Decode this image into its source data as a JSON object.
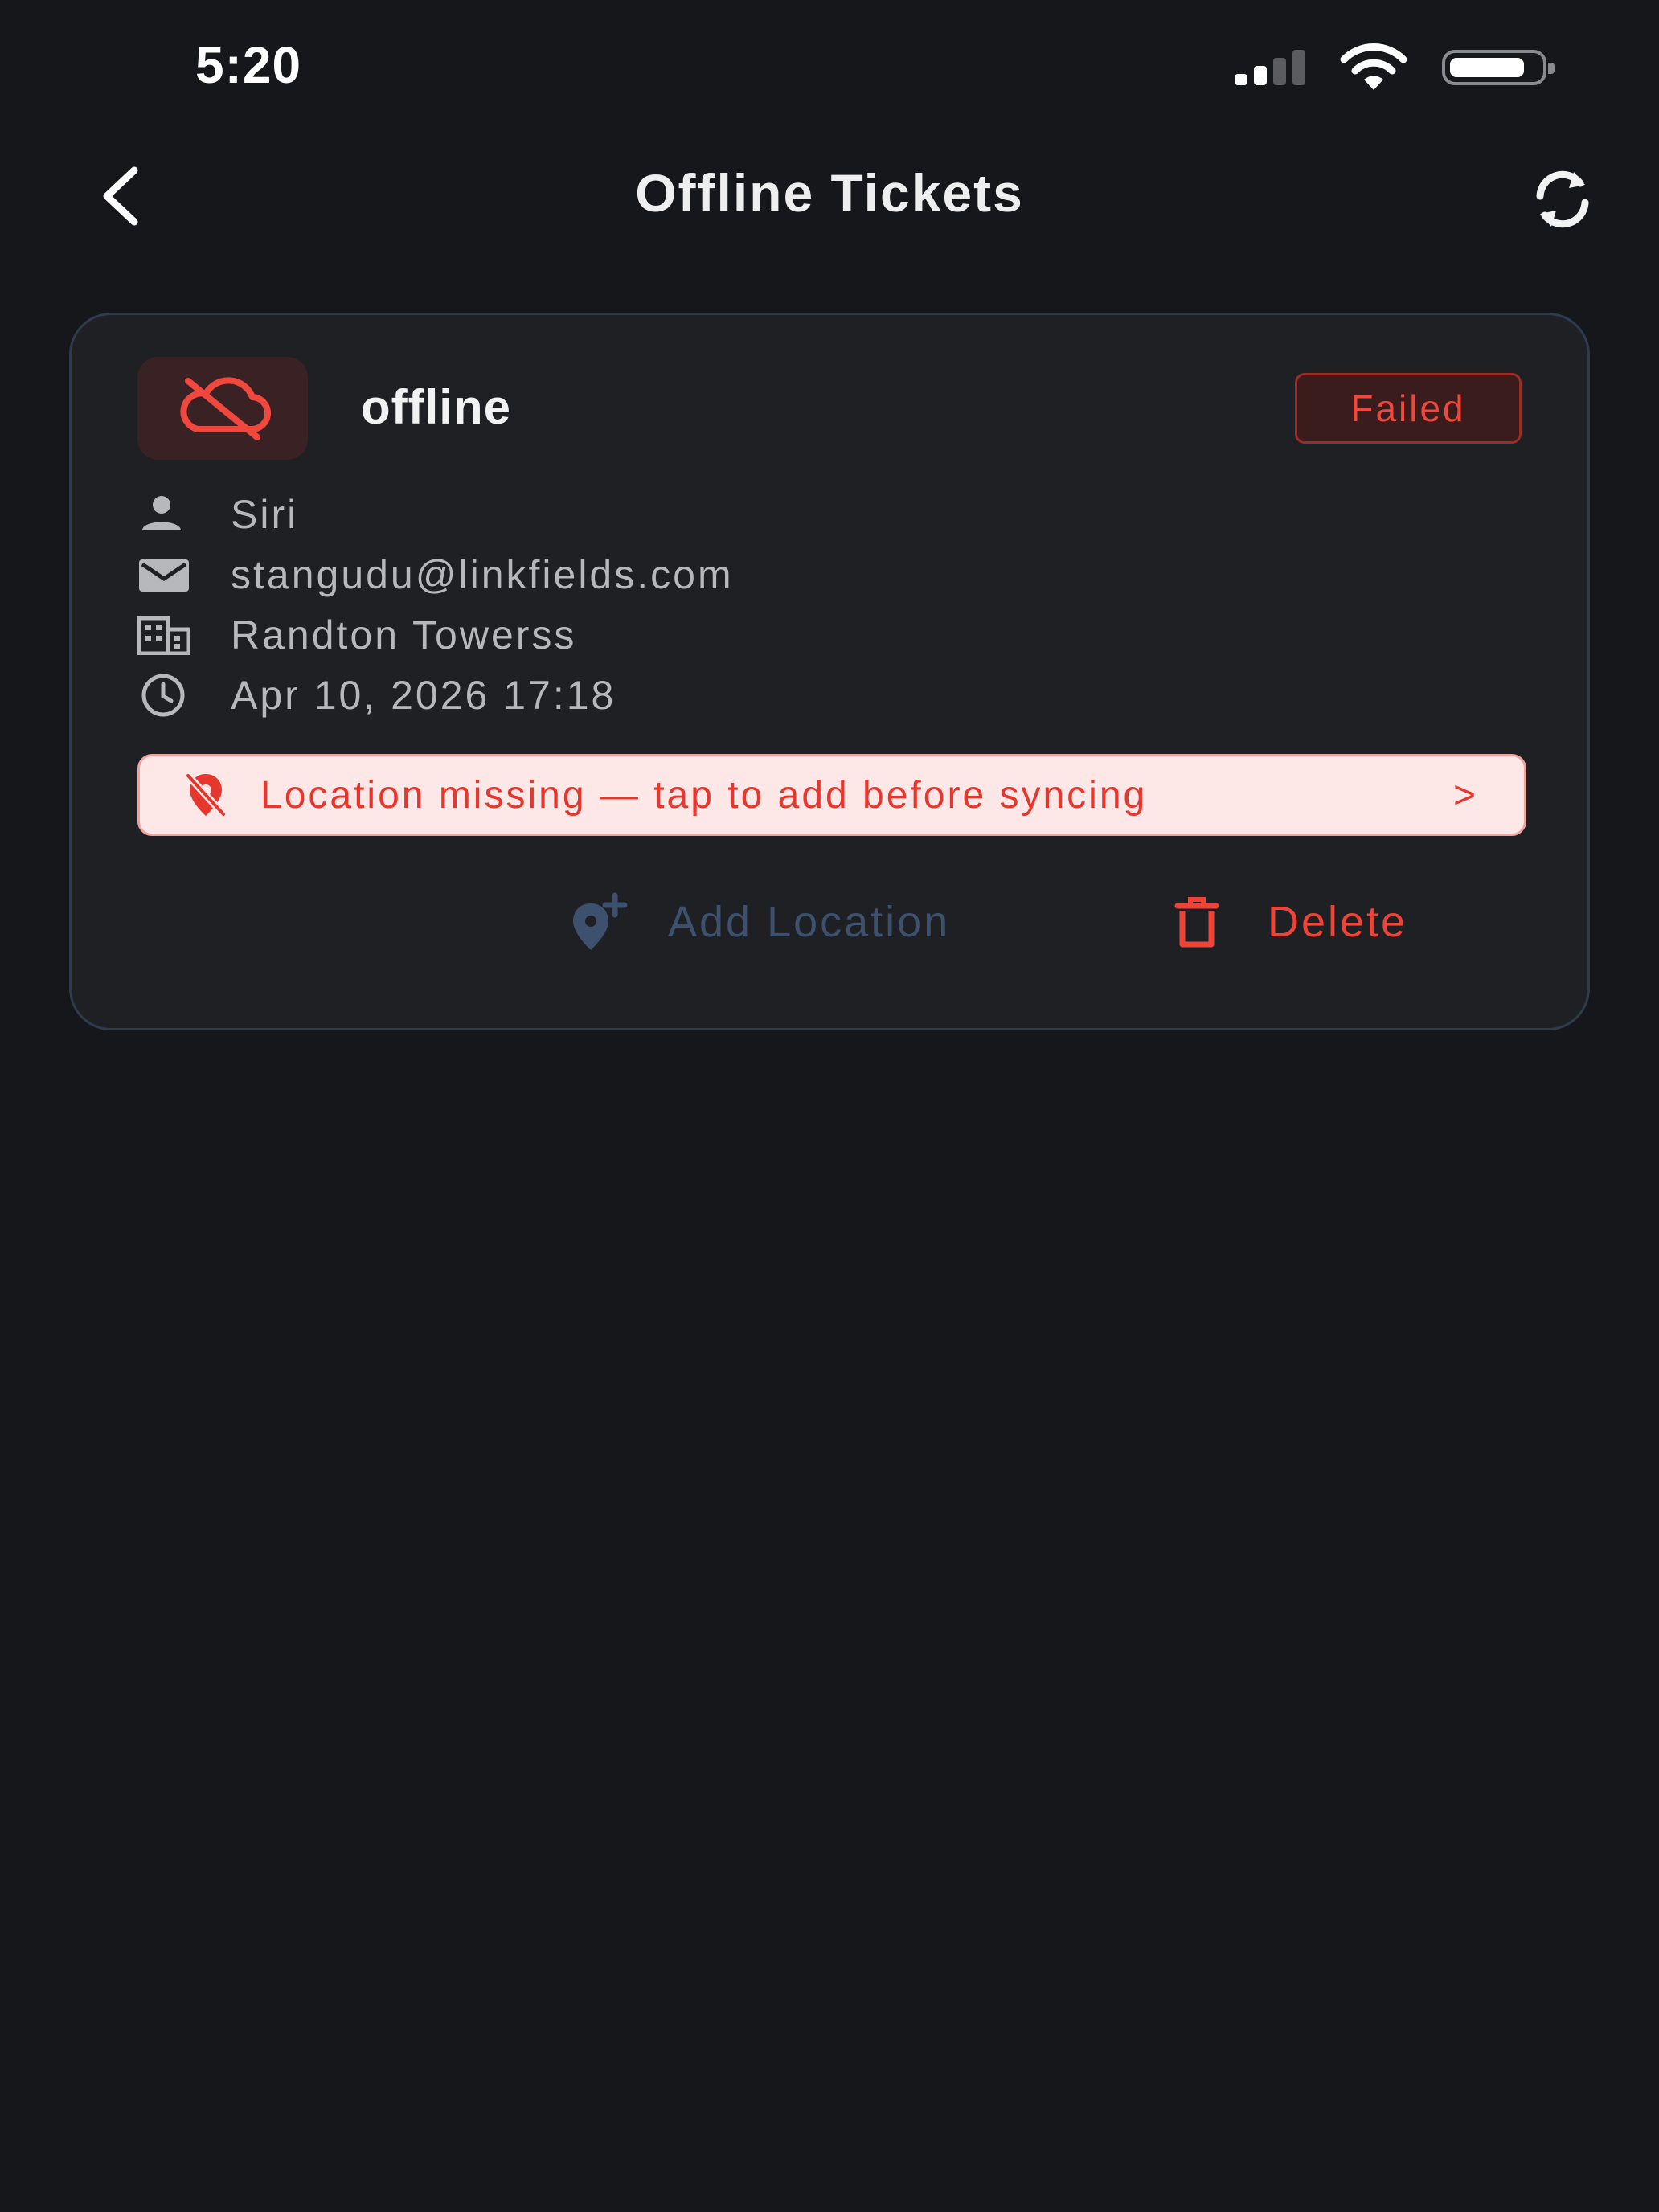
{
  "status_bar": {
    "time": "5:20"
  },
  "header": {
    "title": "Offline Tickets",
    "back_icon": "chevron-left-icon",
    "sync_icon": "sync-icon"
  },
  "ticket": {
    "title": "offline",
    "status": "Failed",
    "status_color": "#f0483e",
    "icon": "cloud-off-icon",
    "details": {
      "name": "Siri",
      "email": "stangudu@linkfields.com",
      "site": "Randton Towerss",
      "datetime": "Apr 10, 2026 17:18"
    },
    "warning": {
      "text": "Location missing — tap to add before syncing",
      "chevron": ">",
      "icon": "location-off-icon"
    },
    "actions": {
      "add_location_label": "Add Location",
      "delete_label": "Delete"
    }
  },
  "colors": {
    "background": "#16171a",
    "card": "#1f2023",
    "card_border": "#2e3a4e",
    "danger": "#ef4338",
    "muted_action": "#3d506d"
  }
}
